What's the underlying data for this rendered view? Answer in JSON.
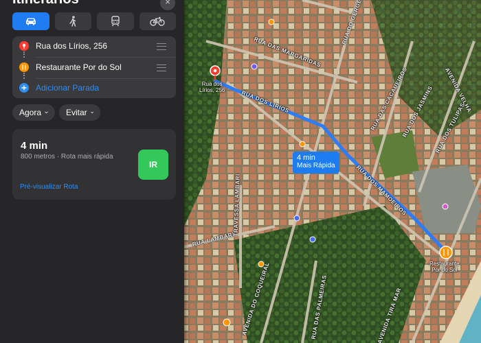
{
  "panel": {
    "title": "Itinerários",
    "close_label": "×",
    "transport_modes": [
      {
        "icon": "car-icon",
        "active": true
      },
      {
        "icon": "walking-icon",
        "active": false
      },
      {
        "icon": "transit-icon",
        "active": false
      },
      {
        "icon": "bicycle-icon",
        "active": false
      }
    ],
    "stops": [
      {
        "label": "Rua dos Lírios, 256",
        "icon": "pin-icon",
        "color": "#ff3b30"
      },
      {
        "label": "Restaurante Por do Sol",
        "icon": "fork-knife-icon",
        "color": "#ff9500"
      },
      {
        "label": "Adicionar Parada",
        "icon": "plus-icon",
        "color": "#2e8cf5"
      }
    ],
    "options": {
      "departure": "Agora",
      "avoid": "Evitar"
    },
    "route": {
      "time": "4 min",
      "details": "800 metros · Rota mais rápida",
      "go_label": "IR",
      "preview_label": "Pré-visualizar Rota"
    }
  },
  "map": {
    "route_callout": {
      "time": "4 min",
      "label": "Mais Rápida"
    },
    "origin_label_line1": "Rua dos",
    "origin_label_line2": "Lírios, 256",
    "destination_label_line1": "Restaurante",
    "destination_label_line2": "Por do Sol",
    "route_color": "#2f7df6",
    "road_labels": [
      "RUA DAS MARGARIDAS",
      "RUA DOS LÍRIOS",
      "RUA DAS CACAUEIROS",
      "RUA DOS JASMINS",
      "RUA DOS TULIPAS",
      "RUA DOS MAMOEIROS",
      "RUA LAMBARI",
      "AVENIDA DO COQUEIRAL",
      "AVENIDA TIRA MAR",
      "TRAVESSA LAMBARI",
      "RUA DO GERGELIM",
      "AVENIDA VELHA",
      "RUA DAS PALMEIRAS"
    ]
  }
}
